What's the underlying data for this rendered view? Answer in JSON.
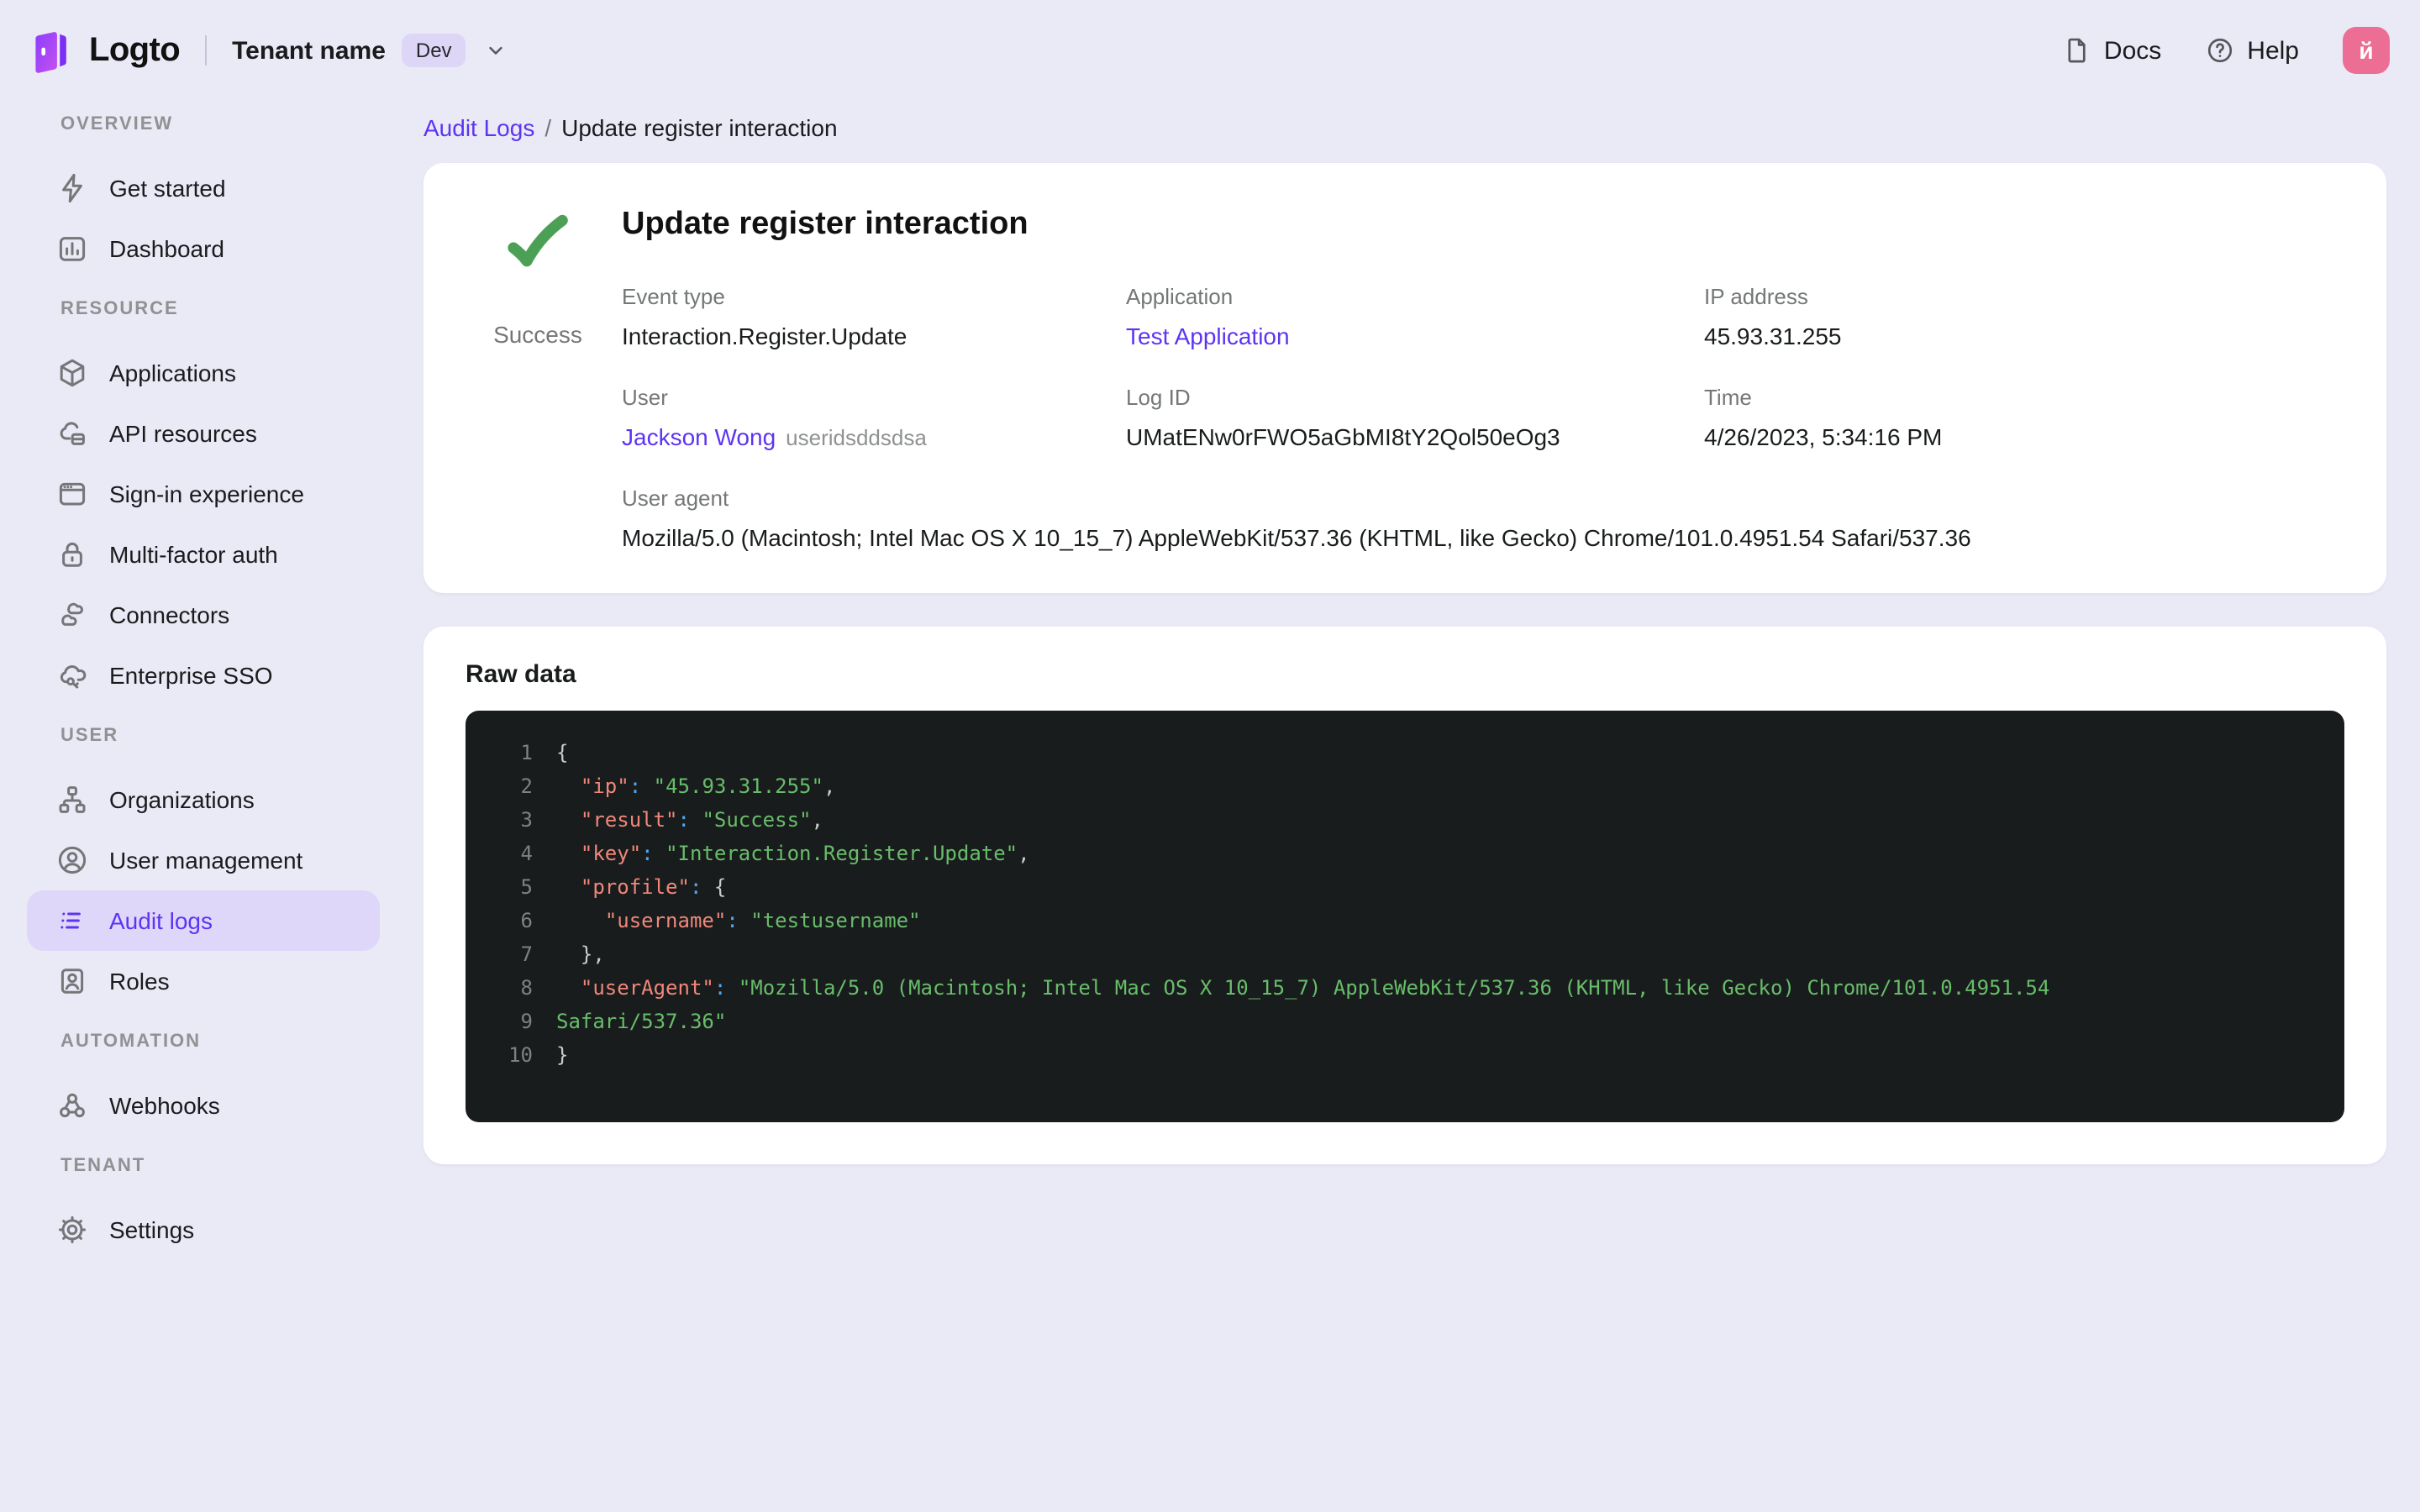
{
  "colors": {
    "accent": "#5d34f2",
    "active_pill_bg": "#ded7fa",
    "page_bg": "#eae9f6",
    "success_green": "#4ca055",
    "avatar_pink": "#ec6e94",
    "badge_bg": "#ddd6f7",
    "code_bg": "#191c1d",
    "code_key": "#f08779",
    "code_string": "#68bd6a",
    "code_colon": "#52a8f0"
  },
  "topbar": {
    "logo_text": "Logto",
    "tenant_name": "Tenant name",
    "env_badge": "Dev",
    "docs_label": "Docs",
    "help_label": "Help",
    "avatar_letter": "й"
  },
  "breadcrumb": {
    "parent": "Audit Logs",
    "separator": "/",
    "current": "Update register interaction"
  },
  "sidebar": {
    "sections": [
      {
        "title": "OVERVIEW",
        "items": [
          {
            "label": "Get started",
            "icon": "bolt-icon",
            "active": false
          },
          {
            "label": "Dashboard",
            "icon": "dashboard-icon",
            "active": false
          }
        ]
      },
      {
        "title": "RESOURCE",
        "items": [
          {
            "label": "Applications",
            "icon": "cube-icon",
            "active": false
          },
          {
            "label": "API resources",
            "icon": "api-resources-icon",
            "active": false
          },
          {
            "label": "Sign-in experience",
            "icon": "browser-icon",
            "active": false
          },
          {
            "label": "Multi-factor auth",
            "icon": "lock-icon",
            "active": false
          },
          {
            "label": "Connectors",
            "icon": "connectors-icon",
            "active": false
          },
          {
            "label": "Enterprise SSO",
            "icon": "sso-cloud-key-icon",
            "active": false
          }
        ]
      },
      {
        "title": "USER",
        "items": [
          {
            "label": "Organizations",
            "icon": "org-chart-icon",
            "active": false
          },
          {
            "label": "User management",
            "icon": "user-circle-icon",
            "active": false
          },
          {
            "label": "Audit logs",
            "icon": "audit-list-icon",
            "active": true
          },
          {
            "label": "Roles",
            "icon": "id-badge-icon",
            "active": false
          }
        ]
      },
      {
        "title": "AUTOMATION",
        "items": [
          {
            "label": "Webhooks",
            "icon": "webhook-icon",
            "active": false
          }
        ]
      },
      {
        "title": "TENANT",
        "items": [
          {
            "label": "Settings",
            "icon": "gear-icon",
            "active": false
          }
        ]
      }
    ]
  },
  "detail_card": {
    "status": "Success",
    "title": "Update register interaction",
    "fields": [
      {
        "label": "Event type",
        "value": "Interaction.Register.Update"
      },
      {
        "label": "Application",
        "value": "Test Application"
      },
      {
        "label": "IP address",
        "value": "45.93.31.255"
      },
      {
        "label": "User",
        "value": "Jackson Wong",
        "suffix": "useridsddsdsa"
      },
      {
        "label": "Log ID",
        "value": "UMatENw0rFWO5aGbMI8tY2Qol50eOg3"
      },
      {
        "label": "Time",
        "value": "4/26/2023, 5:34:16 PM"
      },
      {
        "label": "User agent",
        "value": "Mozilla/5.0 (Macintosh; Intel Mac OS X 10_15_7) AppleWebKit/537.36 (KHTML, like Gecko) Chrome/101.0.4951.54 Safari/537.36"
      }
    ]
  },
  "raw_data": {
    "title": "Raw data",
    "lines": [
      {
        "n": "1",
        "tokens": [
          [
            "p",
            "{"
          ]
        ]
      },
      {
        "n": "2",
        "tokens": [
          [
            "p",
            "  "
          ],
          [
            "k",
            "\"ip\""
          ],
          [
            "c",
            ":"
          ],
          [
            "p",
            " "
          ],
          [
            "s",
            "\"45.93.31.255\""
          ],
          [
            "p",
            ","
          ]
        ]
      },
      {
        "n": "3",
        "tokens": [
          [
            "p",
            "  "
          ],
          [
            "k",
            "\"result\""
          ],
          [
            "c",
            ":"
          ],
          [
            "p",
            " "
          ],
          [
            "s",
            "\"Success\""
          ],
          [
            "p",
            ","
          ]
        ]
      },
      {
        "n": "4",
        "tokens": [
          [
            "p",
            "  "
          ],
          [
            "k",
            "\"key\""
          ],
          [
            "c",
            ":"
          ],
          [
            "p",
            " "
          ],
          [
            "s",
            "\"Interaction.Register.Update\""
          ],
          [
            "p",
            ","
          ]
        ]
      },
      {
        "n": "5",
        "tokens": [
          [
            "p",
            "  "
          ],
          [
            "k",
            "\"profile\""
          ],
          [
            "c",
            ":"
          ],
          [
            "p",
            " "
          ],
          [
            "p",
            "{"
          ]
        ]
      },
      {
        "n": "6",
        "tokens": [
          [
            "p",
            "    "
          ],
          [
            "k",
            "\"username\""
          ],
          [
            "c",
            ":"
          ],
          [
            "p",
            " "
          ],
          [
            "s",
            "\"testusername\""
          ]
        ]
      },
      {
        "n": "7",
        "tokens": [
          [
            "p",
            "  },"
          ]
        ]
      },
      {
        "n": "8",
        "tokens": [
          [
            "p",
            "  "
          ],
          [
            "k",
            "\"userAgent\""
          ],
          [
            "c",
            ":"
          ],
          [
            "p",
            " "
          ],
          [
            "s",
            "\"Mozilla/5.0 (Macintosh; Intel Mac OS X 10_15_7) AppleWebKit/537.36 (KHTML, like Gecko) Chrome/101.0.4951.54"
          ]
        ]
      },
      {
        "n": "9",
        "tokens": [
          [
            "s",
            "Safari/537.36\""
          ]
        ]
      },
      {
        "n": "10",
        "tokens": [
          [
            "p",
            "}"
          ]
        ]
      }
    ]
  }
}
